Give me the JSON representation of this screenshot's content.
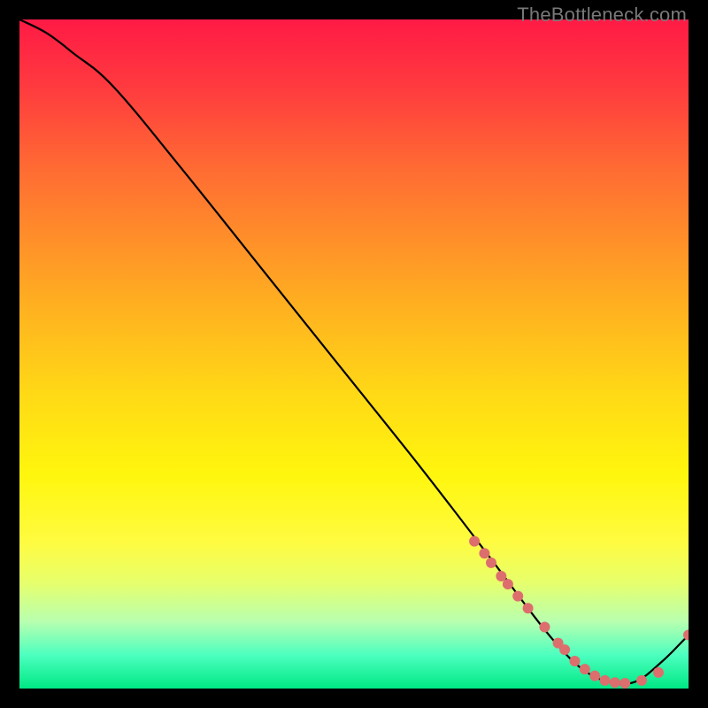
{
  "watermark": "TheBottleneck.com",
  "chart_data": {
    "type": "line",
    "title": "",
    "xlabel": "",
    "ylabel": "",
    "xlim": [
      0,
      100
    ],
    "ylim": [
      0,
      100
    ],
    "series": [
      {
        "name": "bottleneck-curve",
        "x": [
          0,
          4,
          8,
          14,
          24,
          36,
          48,
          60,
          70,
          76,
          80,
          84,
          88,
          92,
          96,
          100
        ],
        "y": [
          100,
          98,
          95,
          90,
          78,
          63,
          48,
          33,
          20,
          12,
          7,
          3,
          1,
          1,
          4,
          8
        ]
      }
    ],
    "points": {
      "name": "scatter-dots",
      "color": "#dd6e6e",
      "radius": 6,
      "x": [
        68,
        69.5,
        70.5,
        72,
        73,
        74.5,
        76,
        78.5,
        80.5,
        81.5,
        83,
        84.5,
        86,
        87.5,
        89,
        90.5,
        93,
        95.5,
        100
      ],
      "y": [
        22,
        20.2,
        18.8,
        16.8,
        15.6,
        13.8,
        12.0,
        9.2,
        6.8,
        5.8,
        4.1,
        2.9,
        1.9,
        1.2,
        0.9,
        0.8,
        1.2,
        2.4,
        8
      ]
    }
  }
}
